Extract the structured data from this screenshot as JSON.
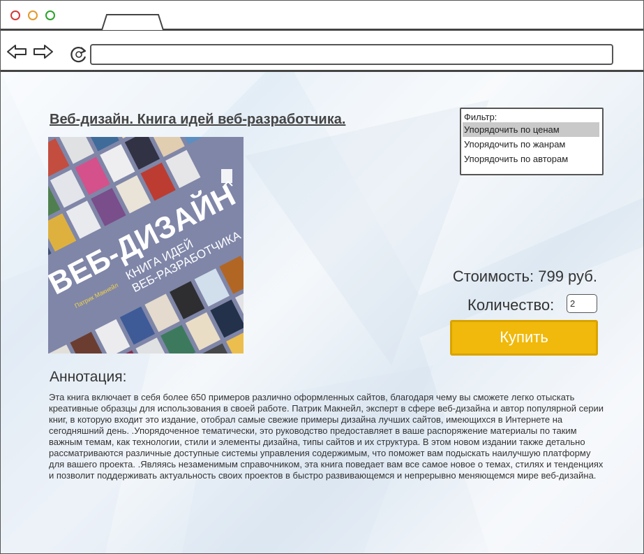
{
  "window": {
    "controls": [
      "close",
      "minimize",
      "maximize"
    ],
    "colors": {
      "close": "#d33a3a",
      "minimize": "#e39a2a",
      "maximize": "#29a329"
    }
  },
  "nav": {
    "icons": [
      "back-arrow-icon",
      "forward-arrow-icon",
      "reload-icon"
    ],
    "url": ""
  },
  "product": {
    "title": "Веб-дизайн. Книга идей веб-разработчика.",
    "cover": {
      "title": "ВЕБ-ДИЗАЙН",
      "subtitle_line1": "КНИГА ИДЕЙ",
      "subtitle_line2": "ВЕБ-РАЗРАБОТЧИКА",
      "author": "Патрик Макнейл",
      "background_color": "#7f86a8"
    },
    "price": "Стоимость: 799 руб.",
    "quantity_label": "Количество:",
    "quantity_value": "2",
    "buy_label": "Купить",
    "buy_color": "#f0b90b"
  },
  "filter": {
    "label": "Фильтр:",
    "options": [
      "Упорядочить по ценам",
      "Упорядочить по жанрам",
      "Упорядочить по авторам"
    ],
    "selected_index": 0
  },
  "annotation": {
    "title": "Аннотация:",
    "text": "Эта книга включает в себя более 650 примеров различно оформленных сайтов, благодаря чему вы сможете легко отыскать креативные образцы для использования в своей работе. Патрик Макнейл, эксперт в сфере веб-дизайна и автор популярной серии книг, в которую входит это издание, отобрал самые свежие примеры дизайна лучших сайтов, имеющихся в Интернете на сегодняшний день. .Упорядоченное тематически, это руководство предоставляет в ваше распоряжение материалы по таким важным темам, как технологии, стили и элементы дизайна, типы сайтов и их структура. В этом новом издании также детально рассматриваются различные доступные системы управления содержимым, что поможет вам подыскать наилучшую платформу для вашего проекта. .Являясь незаменимым справочником, эта книга поведает вам все самое новое о темах, стилях и тенденциях и позволит поддерживать актуальность своих проектов в быстро развивающемся и непрерывно меняющемся мире веб-дизайна."
  }
}
